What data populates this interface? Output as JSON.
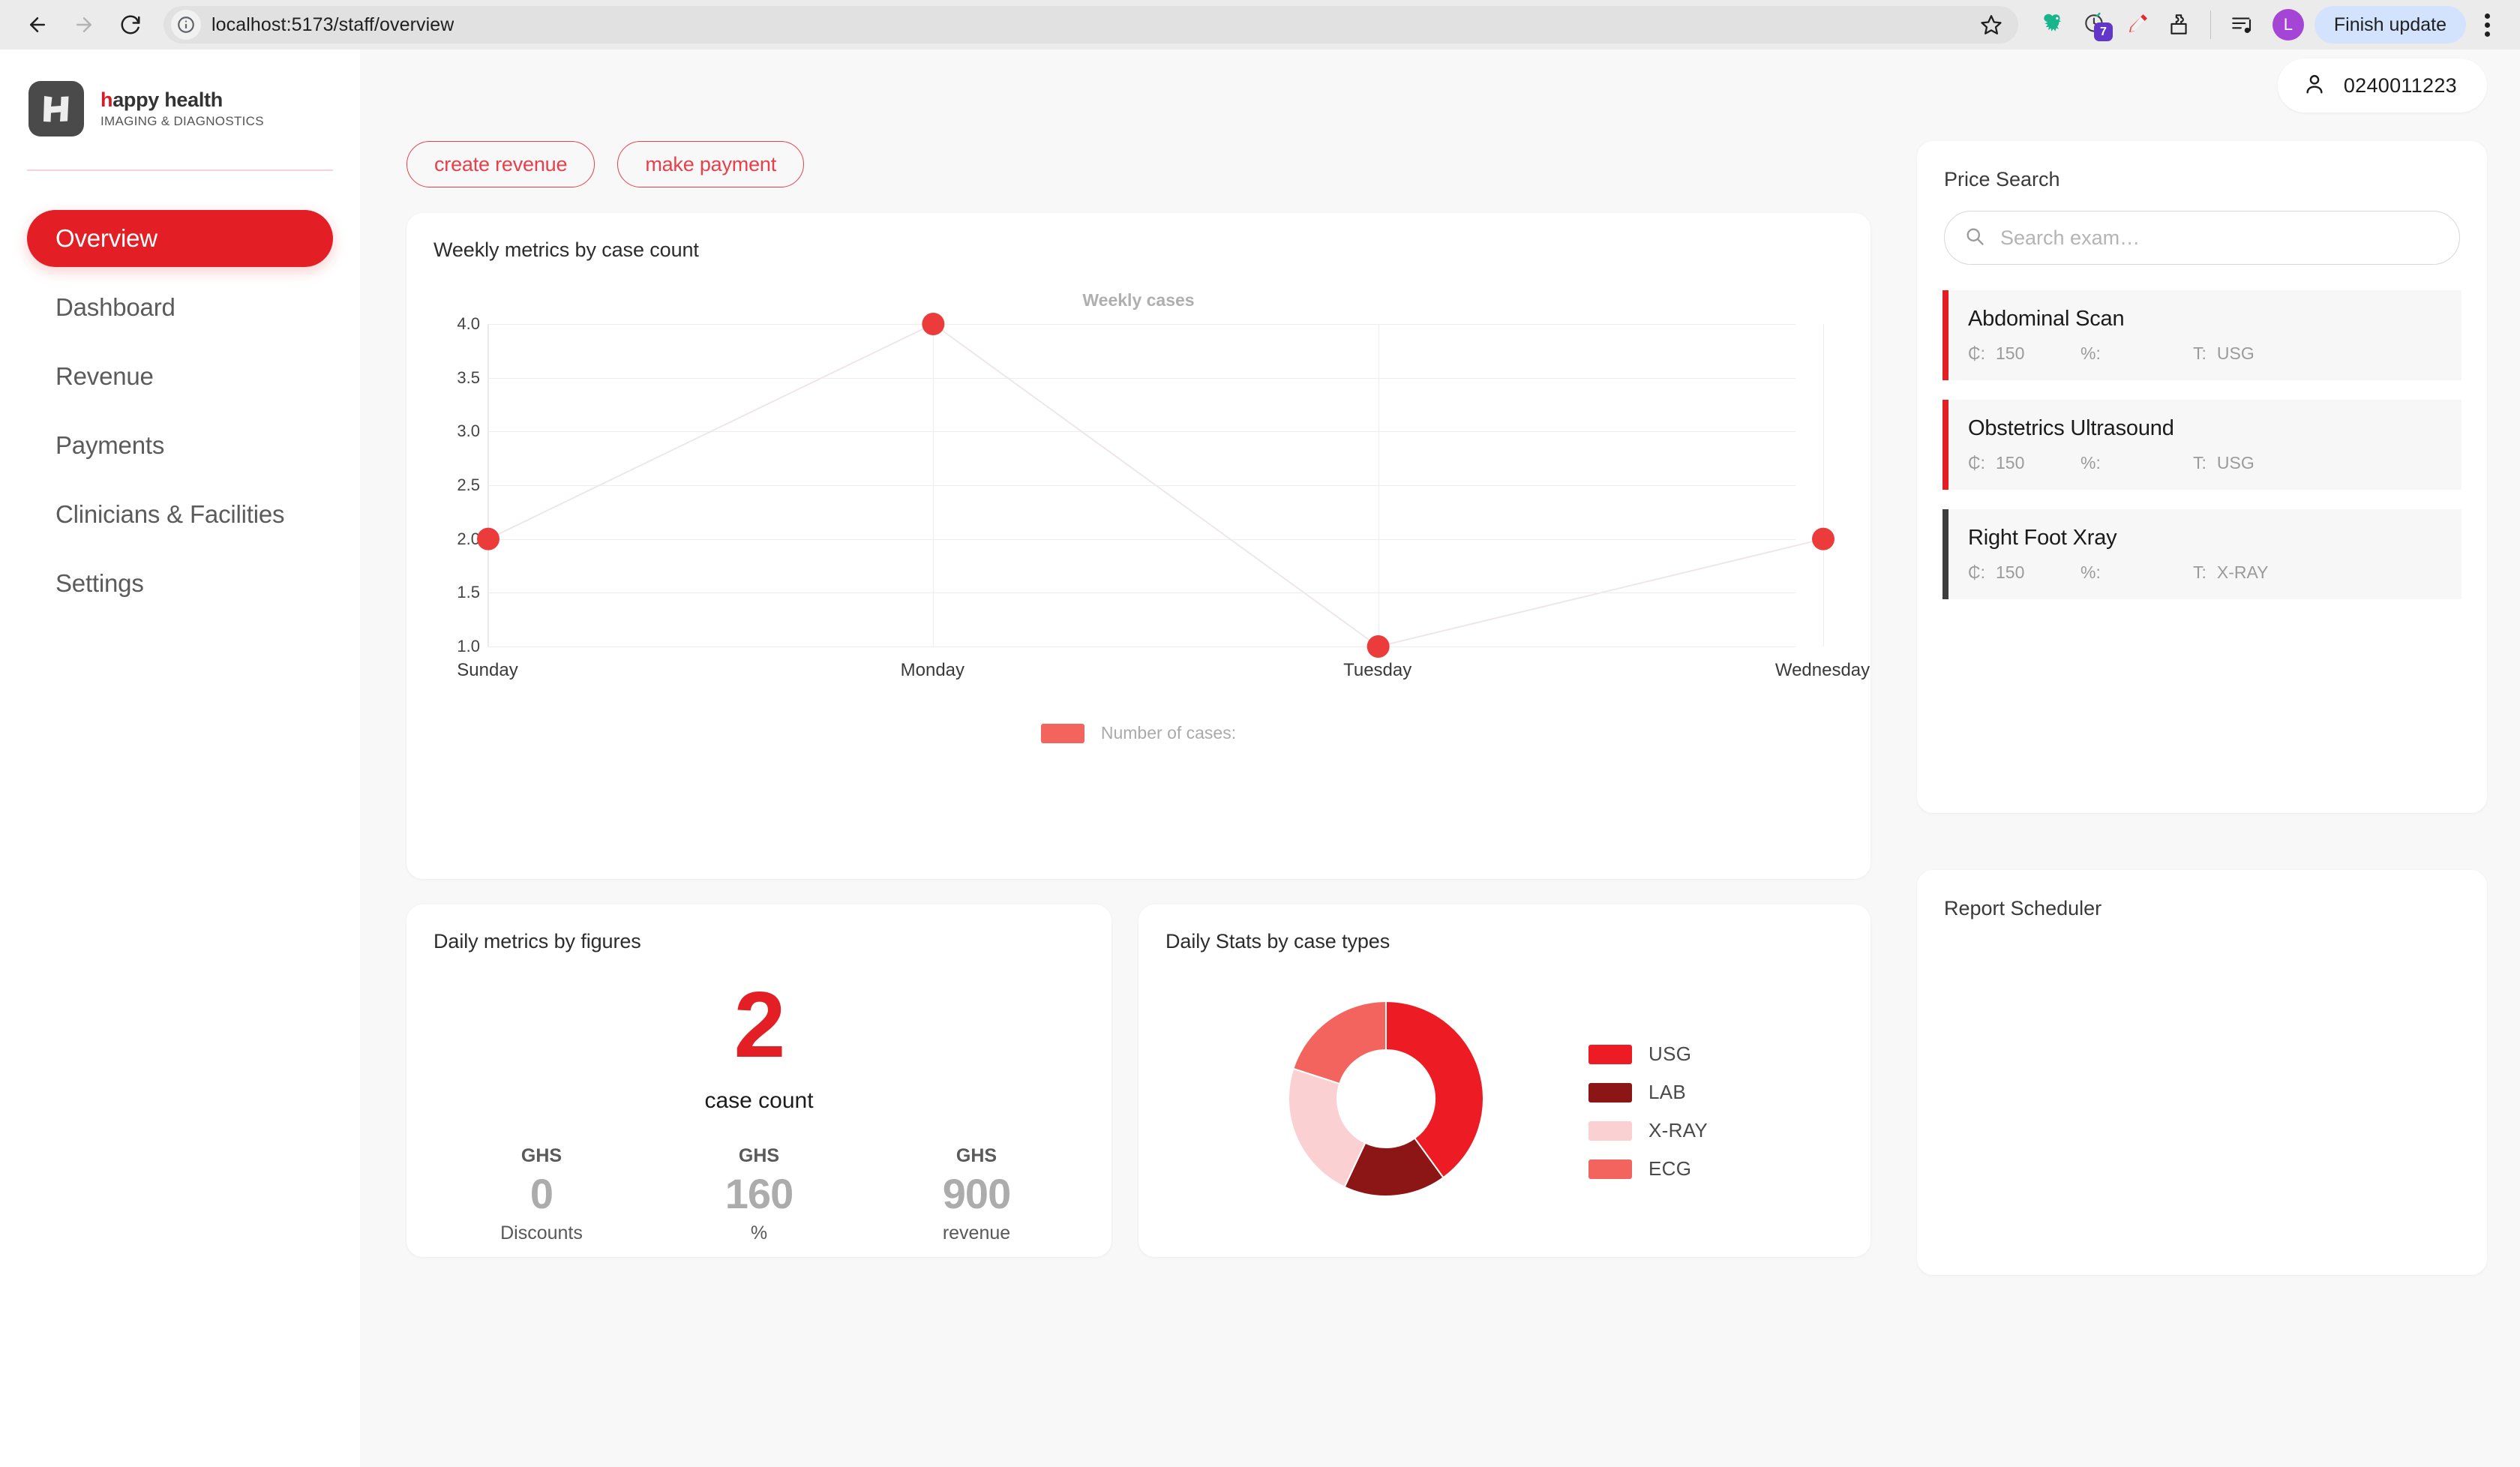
{
  "browser": {
    "back_icon": "back-arrow-icon",
    "forward_icon": "forward-arrow-icon",
    "reload_icon": "reload-icon",
    "site_info_icon": "site-info-icon",
    "url": "localhost:5173/staff/overview",
    "bookmark_icon": "star-icon",
    "extensions": [
      {
        "name": "dinosaur-extension-icon",
        "badge": ""
      },
      {
        "name": "clock-extension-icon",
        "badge": "7"
      },
      {
        "name": "pen-extension-icon",
        "badge": ""
      },
      {
        "name": "puzzle-extensions-icon",
        "badge": ""
      }
    ],
    "reading_list_icon": "reading-list-icon",
    "profile_initial": "L",
    "finish_update_label": "Finish update",
    "menu_icon": "three-dot-menu-icon"
  },
  "sidebar": {
    "brand": {
      "logo_icon": "happy-health-h-logo",
      "name_accent": "h",
      "name_rest": "appy health",
      "tagline": "IMAGING & DIAGNOSTICS"
    },
    "items": [
      {
        "label": "Overview",
        "active": true
      },
      {
        "label": "Dashboard",
        "active": false
      },
      {
        "label": "Revenue",
        "active": false
      },
      {
        "label": "Payments",
        "active": false
      },
      {
        "label": "Clinicians & Facilities",
        "active": false
      },
      {
        "label": "Settings",
        "active": false
      }
    ]
  },
  "topbar": {
    "user_icon": "person-icon",
    "user_label": "0240011223"
  },
  "actions": {
    "create_revenue_label": "create revenue",
    "make_payment_label": "make payment"
  },
  "weekly_card": {
    "title": "Weekly metrics by case count"
  },
  "daily_metrics": {
    "title": "Daily metrics by figures",
    "case_count_value": "2",
    "case_count_label": "case count",
    "figures": [
      {
        "unit": "GHS",
        "value": "0",
        "label": "Discounts"
      },
      {
        "unit": "GHS",
        "value": "160",
        "label": "%"
      },
      {
        "unit": "GHS",
        "value": "900",
        "label": "revenue"
      }
    ]
  },
  "daily_stats": {
    "title": "Daily Stats by case types"
  },
  "price_search": {
    "title": "Price Search",
    "search_icon": "search-icon",
    "placeholder": "Search exam…",
    "value": "",
    "results": [
      {
        "name": "Abdominal Scan",
        "price_key": "₵:",
        "price": "150",
        "pct_key": "%:",
        "pct": "",
        "type_key": "T:",
        "type": "USG",
        "accent": "#E31E24"
      },
      {
        "name": "Obstetrics Ultrasound",
        "price_key": "₵:",
        "price": "150",
        "pct_key": "%:",
        "pct": "",
        "type_key": "T:",
        "type": "USG",
        "accent": "#E31E24"
      },
      {
        "name": "Right Foot Xray",
        "price_key": "₵:",
        "price": "150",
        "pct_key": "%:",
        "pct": "",
        "type_key": "T:",
        "type": "X-RAY",
        "accent": "#3D3D3D"
      }
    ]
  },
  "report_scheduler": {
    "title": "Report Scheduler"
  },
  "colors": {
    "brand_red": "#E31E24",
    "usg": "#ED1C24",
    "lab": "#8C1515",
    "xray": "#FBD0D2",
    "ecg": "#F4645F"
  },
  "chart_data": [
    {
      "type": "line",
      "title": "Weekly cases",
      "card_title": "Weekly metrics by case count",
      "categories": [
        "Sunday",
        "Monday",
        "Tuesday",
        "Wednesday"
      ],
      "series": [
        {
          "name": "Number of cases:",
          "values": [
            2,
            4,
            1,
            2
          ],
          "color": "#F4645F"
        }
      ],
      "yticks": [
        1.0,
        1.5,
        2.0,
        2.5,
        3.0,
        3.5,
        4.0
      ],
      "ytick_labels": [
        "1.0",
        "1.5",
        "2.0",
        "2.5",
        "3.0",
        "3.5",
        "4.0"
      ],
      "ylim": [
        1.0,
        4.0
      ],
      "xlabel": "",
      "ylabel": "",
      "grid": true,
      "legend": "bottom",
      "legend_entries": [
        "Number of cases:"
      ],
      "marker": "circle",
      "marker_color": "#EB3B3B"
    },
    {
      "type": "pie",
      "variant": "donut",
      "title": "Daily Stats by case types",
      "labels": [
        "USG",
        "LAB",
        "X-RAY",
        "ECG"
      ],
      "values": [
        40,
        17,
        23,
        20
      ],
      "colors": [
        "#ED1C24",
        "#8C1515",
        "#FBD0D2",
        "#F4645F"
      ],
      "legend": "right",
      "inner_radius_ratio": 0.5
    }
  ]
}
